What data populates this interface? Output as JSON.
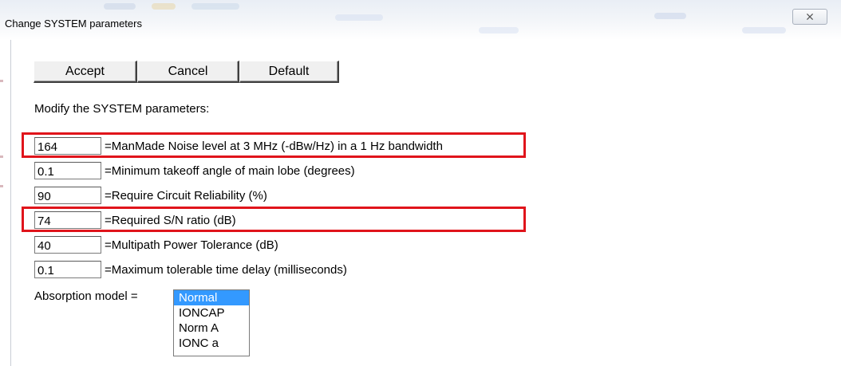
{
  "window": {
    "title": "Change SYSTEM parameters",
    "close_icon": "close-icon"
  },
  "toolbar": {
    "accept_label": "Accept",
    "cancel_label": "Cancel",
    "default_label": "Default"
  },
  "instruction": "Modify the SYSTEM parameters:",
  "parameters": [
    {
      "value": "164",
      "label": "=ManMade Noise level at 3 MHz (-dBw/Hz) in a 1 Hz bandwidth",
      "highlighted": true
    },
    {
      "value": "0.1",
      "label": "=Minimum takeoff angle of main lobe (degrees)",
      "highlighted": false
    },
    {
      "value": "90",
      "label": "=Require Circuit Reliability (%)",
      "highlighted": false
    },
    {
      "value": "74",
      "label": "=Required S/N ratio (dB)",
      "highlighted": true
    },
    {
      "value": "40",
      "label": "=Multipath Power Tolerance (dB)",
      "highlighted": false
    },
    {
      "value": "0.1",
      "label": "=Maximum tolerable time delay (milliseconds)",
      "highlighted": false
    }
  ],
  "absorption": {
    "label": "Absorption model =",
    "options": [
      "Normal",
      "IONCAP",
      "Norm A",
      "IONC a"
    ],
    "selected": "Normal"
  },
  "colors": {
    "highlight": "#e0141b",
    "selection": "#3399ff"
  }
}
